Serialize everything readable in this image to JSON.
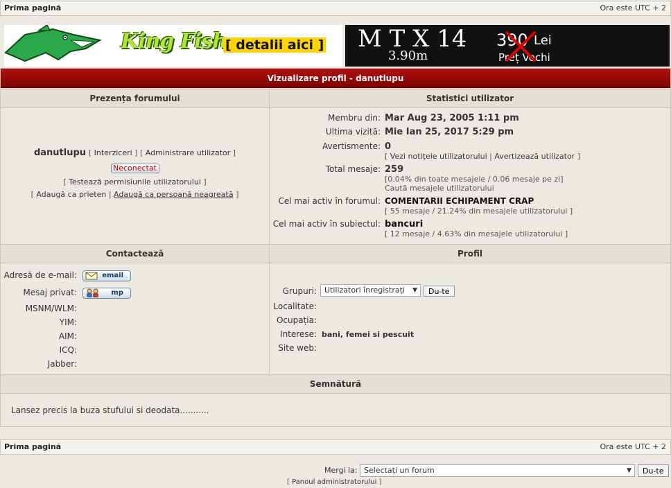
{
  "nav": {
    "home": "Prima pagină",
    "time": "Ora este UTC + 2"
  },
  "banner_left": {
    "brand": "King Fish",
    "link": "[ detalii aici ]"
  },
  "banner_right": {
    "model": "M T X 14",
    "length": "3.90m",
    "old_price": "390",
    "currency": "Lei",
    "old_label": "Preț Vechi"
  },
  "page": {
    "title": "Vizualizare profil - danutlupu"
  },
  "presence": {
    "header": "Prezența forumului",
    "username": "danutlupu",
    "links": {
      "bans": "Interziceri",
      "admin_user": "Administrare utilizator"
    },
    "status": "Neconectat",
    "test_perms": "Testează permisiunile utilizatorului",
    "add_friend": "Adaugă ca prieten",
    "add_foe": "Adaugă ca persoană neagreată"
  },
  "stats": {
    "header": "Statistici utilizator",
    "member_since_label": "Membru din:",
    "member_since": "Mar Aug 23, 2005 1:11 pm",
    "last_visit_label": "Ultima vizită:",
    "last_visit": "Mie Ian 25, 2017 5:29 pm",
    "warnings_label": "Avertismente:",
    "warnings": "0",
    "view_notes": "Vezi notițele utilizatorului",
    "warn_user": "Avertizează utilizator",
    "total_posts_label": "Total mesaje:",
    "total_posts": "259",
    "posts_detail": "[0.04% din toate mesajele / 0.06 mesaje pe zi]",
    "search_posts": "Caută mesajele utilizatorului",
    "active_forum_label": "Cel mai activ în forumul:",
    "active_forum": "COMENTARII ECHIPAMENT CRAP",
    "active_forum_detail": "[ 55 mesaje / 21.24% din mesajele utilizatorului ]",
    "active_topic_label": "Cel mai activ în subiectul:",
    "active_topic": "bancuri",
    "active_topic_detail": "[ 12 mesaje / 4.63% din mesajele utilizatorului ]"
  },
  "contact": {
    "header": "Contactează",
    "email_label": "Adresă de e-mail:",
    "email_btn": "email",
    "pm_label": "Mesaj privat:",
    "pm_btn": "mp",
    "msnm_label": "MSNM/WLM:",
    "yim_label": "YIM:",
    "aim_label": "AIM:",
    "icq_label": "ICQ:",
    "jabber_label": "Jabber:"
  },
  "profile": {
    "header": "Profil",
    "groups_label": "Grupuri:",
    "groups_value": "Utilizatori înregistrați",
    "go_btn": "Du-te",
    "location_label": "Localitate:",
    "occupation_label": "Ocupația:",
    "interests_label": "Interese:",
    "interests_value": "bani, femei si pescuit",
    "website_label": "Site web:"
  },
  "signature": {
    "header": "Semnătură",
    "text": "Lansez precis la buza stufului si deodata..........."
  },
  "jump": {
    "label": "Mergi la:",
    "value": "Selectați un forum",
    "go_btn": "Du-te"
  },
  "admin_panel": "Panoul administratorului"
}
